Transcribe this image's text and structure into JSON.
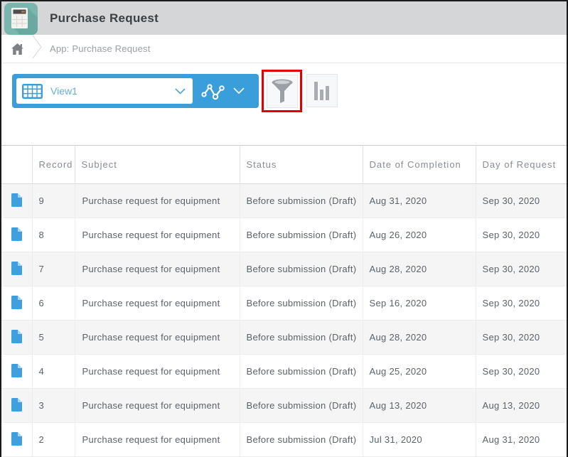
{
  "header": {
    "title": "Purchase Request"
  },
  "breadcrumb": {
    "label": "App: Purchase Request"
  },
  "toolbar": {
    "view_name": "View1",
    "filter_highlighted": true
  },
  "colors": {
    "accent_blue": "#3a9edb",
    "header_bar": "#d4d6d8",
    "app_icon_teal": "#7ab6ae",
    "app_icon_shadow": "#68a89f",
    "highlight_red": "#e00000",
    "row_alt": "#f5f5f6",
    "icon_grey": "#9aa0a5"
  },
  "icons": {
    "app": "calculator-app-icon",
    "home": "home-icon",
    "view_table": "table-grid-icon",
    "graph": "line-chart-icon",
    "filter": "funnel-icon",
    "chart": "bar-chart-icon",
    "row": "document-icon",
    "chevron": "chevron-down-icon"
  },
  "table": {
    "columns": [
      "",
      "Record",
      "Subject",
      "Status",
      "Date of Completion",
      "Day of Request"
    ],
    "rows": [
      {
        "record": "9",
        "subject": "Purchase request for equipment",
        "status": "Before submission (Draft)",
        "date_of_completion": "Aug 31, 2020",
        "day_of_request": "Sep 30, 2020"
      },
      {
        "record": "8",
        "subject": "Purchase request for equipment",
        "status": "Before submission (Draft)",
        "date_of_completion": "Aug 26, 2020",
        "day_of_request": "Sep 30, 2020"
      },
      {
        "record": "7",
        "subject": "Purchase request for equipment",
        "status": "Before submission (Draft)",
        "date_of_completion": "Aug 28, 2020",
        "day_of_request": "Sep 30, 2020"
      },
      {
        "record": "6",
        "subject": "Purchase request for equipment",
        "status": "Before submission (Draft)",
        "date_of_completion": "Sep 16, 2020",
        "day_of_request": "Sep 30, 2020"
      },
      {
        "record": "5",
        "subject": "Purchase request for equipment",
        "status": "Before submission (Draft)",
        "date_of_completion": "Aug 28, 2020",
        "day_of_request": "Sep 30, 2020"
      },
      {
        "record": "4",
        "subject": "Purchase request for equipment",
        "status": "Before submission (Draft)",
        "date_of_completion": "Aug 25, 2020",
        "day_of_request": "Sep 30, 2020"
      },
      {
        "record": "3",
        "subject": "Purchase request for equipment",
        "status": "Before submission (Draft)",
        "date_of_completion": "Aug 13, 2020",
        "day_of_request": "Aug 13, 2020"
      },
      {
        "record": "2",
        "subject": "Purchase request for equipment",
        "status": "Before submission (Draft)",
        "date_of_completion": "Jul 31, 2020",
        "day_of_request": "Aug 31, 2020"
      }
    ]
  }
}
